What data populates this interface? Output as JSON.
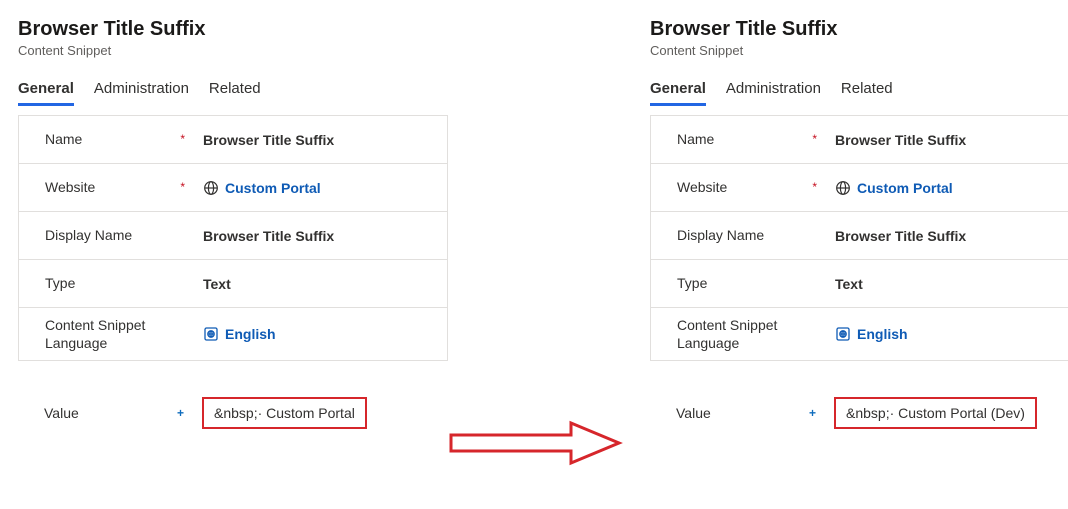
{
  "left": {
    "title": "Browser Title Suffix",
    "subtitle": "Content Snippet",
    "tabs": {
      "general": "General",
      "administration": "Administration",
      "related": "Related"
    },
    "fields": {
      "name": {
        "label": "Name",
        "value": "Browser Title Suffix"
      },
      "website": {
        "label": "Website",
        "value": "Custom Portal"
      },
      "displayName": {
        "label": "Display Name",
        "value": "Browser Title Suffix"
      },
      "type": {
        "label": "Type",
        "value": "Text"
      },
      "lang": {
        "label": "Content Snippet Language",
        "value": "English"
      },
      "valueField": {
        "label": "Value",
        "value": "&nbsp;· Custom Portal"
      }
    }
  },
  "right": {
    "title": "Browser Title Suffix",
    "subtitle": "Content Snippet",
    "tabs": {
      "general": "General",
      "administration": "Administration",
      "related": "Related"
    },
    "fields": {
      "name": {
        "label": "Name",
        "value": "Browser Title Suffix"
      },
      "website": {
        "label": "Website",
        "value": "Custom Portal"
      },
      "displayName": {
        "label": "Display Name",
        "value": "Browser Title Suffix"
      },
      "type": {
        "label": "Type",
        "value": "Text"
      },
      "lang": {
        "label": "Content Snippet Language",
        "value": "English"
      },
      "valueField": {
        "label": "Value",
        "value": "&nbsp;· Custom Portal (Dev)"
      }
    }
  }
}
